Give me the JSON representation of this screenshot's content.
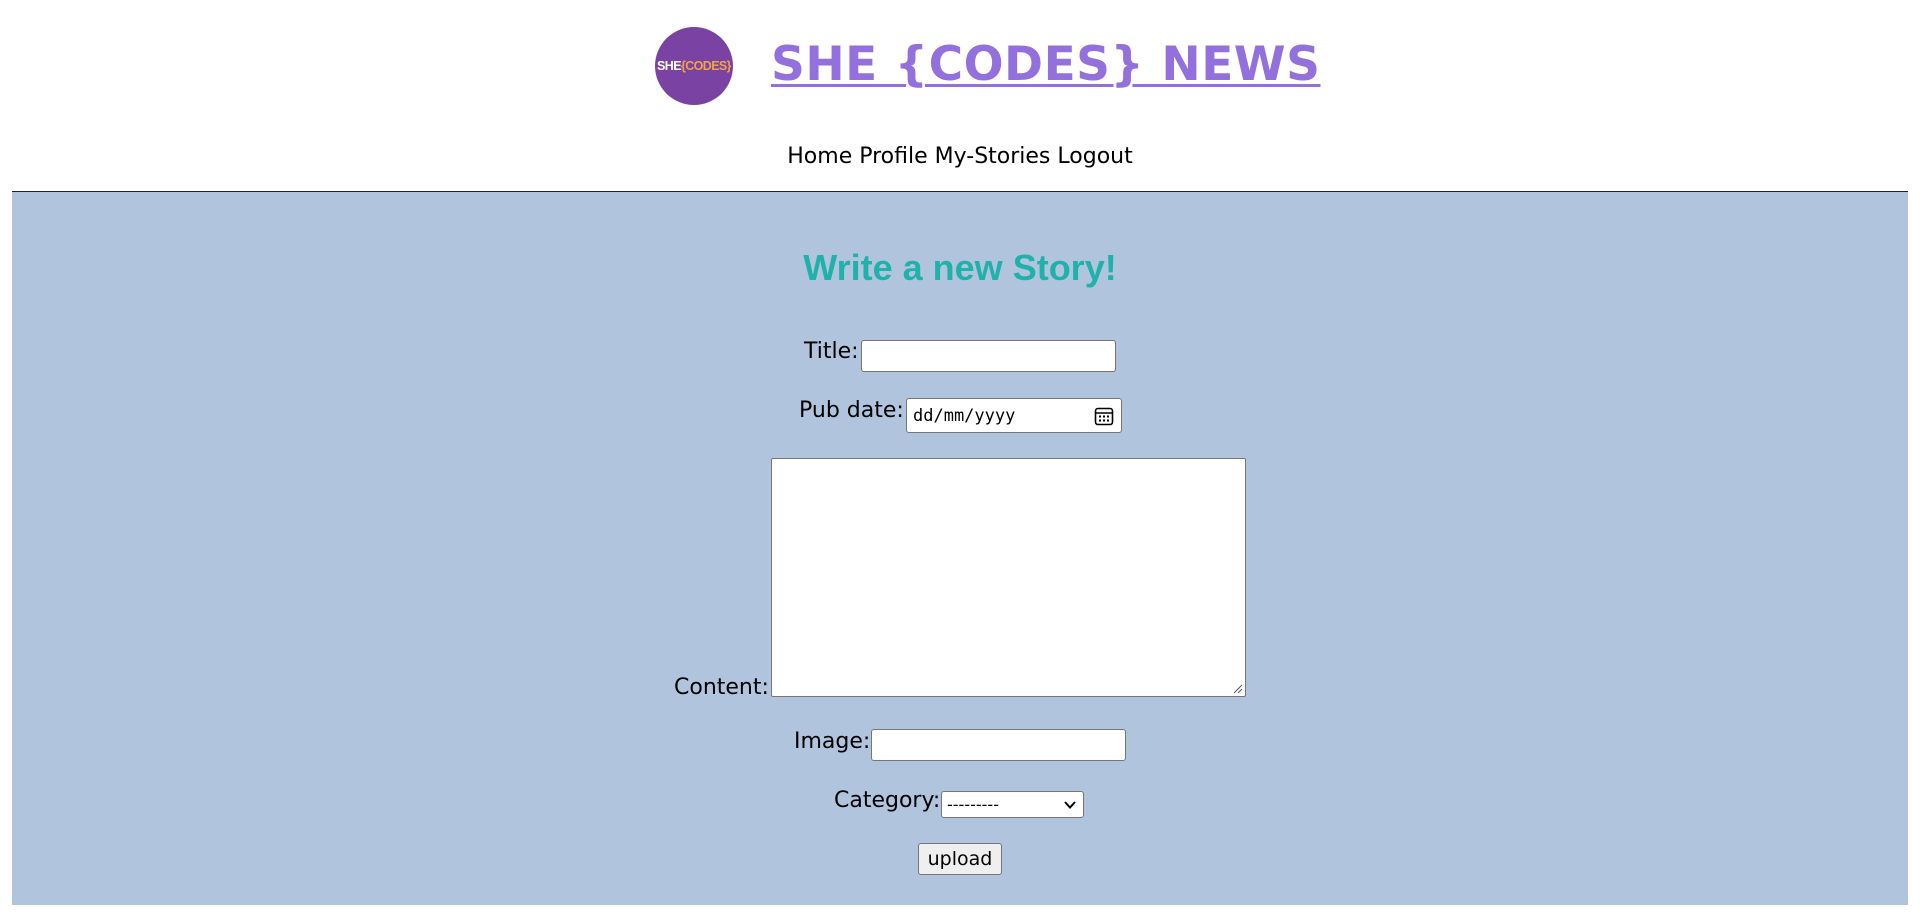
{
  "header": {
    "logo": {
      "text_she": "SHE",
      "text_codes": "{CODES}"
    },
    "title": "SHE {CODES} NEWS"
  },
  "nav": {
    "items": [
      {
        "label": "Home"
      },
      {
        "label": "Profile"
      },
      {
        "label": "My-Stories"
      },
      {
        "label": "Logout"
      }
    ]
  },
  "form": {
    "heading": "Write a new Story!",
    "title_label": "Title:",
    "title_value": "",
    "pub_date_label": "Pub date:",
    "pub_date_placeholder": "dd/mm/yyyy",
    "content_label": "Content:",
    "content_value": "",
    "image_label": "Image:",
    "image_value": "",
    "category_label": "Category:",
    "category_selected": "---------",
    "upload_label": "upload"
  },
  "colors": {
    "title": "#9370db",
    "logo_bg": "#7a42a3",
    "logo_accent": "#f2a445",
    "heading": "#20b2aa",
    "main_bg": "#b0c4de"
  },
  "icons": {
    "date_picker": "calendar-icon",
    "select_arrow": "chevron-down-icon",
    "textarea_resize": "resize-grip-icon"
  }
}
